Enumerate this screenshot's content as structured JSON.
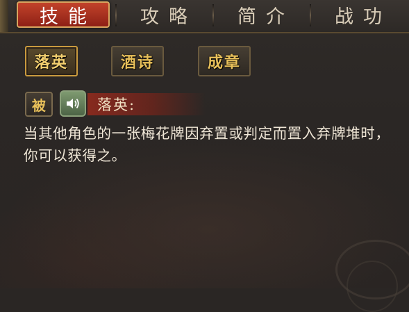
{
  "tabs": [
    {
      "label": "技能",
      "active": true
    },
    {
      "label": "攻略",
      "active": false
    },
    {
      "label": "简介",
      "active": false
    },
    {
      "label": "战功",
      "active": false
    }
  ],
  "skill_buttons": [
    {
      "label": "落英",
      "selected": true
    },
    {
      "label": "酒诗",
      "selected": false
    },
    {
      "label": "成章",
      "selected": false
    }
  ],
  "skill": {
    "type_tag": "被",
    "voice_icon": "speaker-icon",
    "name": "落英:",
    "description": "当其他角色的一张梅花牌因弃置或判定而置入弃牌堆时，你可以获得之。"
  },
  "colors": {
    "active_tab": "#b53a24",
    "gold_text": "#e8c05a",
    "voice_green": "#6f8a62"
  }
}
